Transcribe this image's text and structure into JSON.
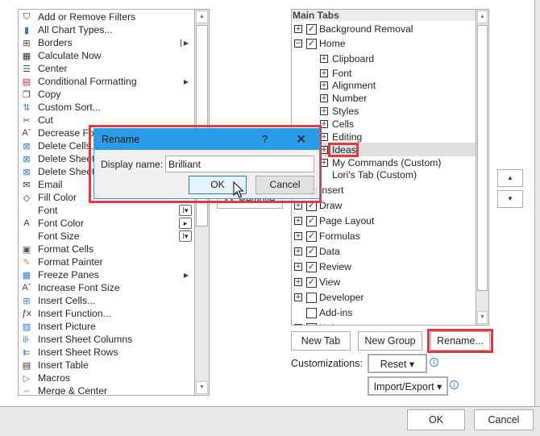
{
  "commands_list": {
    "items": [
      {
        "label": "Add or Remove Filters",
        "icon": "filter-icon",
        "glyph": "⛉"
      },
      {
        "label": "All Chart Types...",
        "icon": "chart-icon",
        "glyph": "▮"
      },
      {
        "label": "Borders",
        "icon": "borders-icon",
        "glyph": "⊞",
        "submenu": "bar"
      },
      {
        "label": "Calculate Now",
        "icon": "calculator-icon",
        "glyph": "▦"
      },
      {
        "label": "Center",
        "icon": "center-align-icon",
        "glyph": "☰"
      },
      {
        "label": "Conditional Formatting",
        "icon": "conditional-formatting-icon",
        "glyph": "▤",
        "submenu": "arrow"
      },
      {
        "label": "Copy",
        "icon": "copy-icon",
        "glyph": "❐"
      },
      {
        "label": "Custom Sort...",
        "icon": "sort-icon",
        "glyph": "⇅"
      },
      {
        "label": "Cut",
        "icon": "scissors-icon",
        "glyph": "✂"
      },
      {
        "label": "Decrease Font Size",
        "icon": "decrease-font-icon",
        "glyph": "Aˇ"
      },
      {
        "label": "Delete Cells...",
        "icon": "delete-cells-icon",
        "glyph": "⊠"
      },
      {
        "label": "Delete Sheet Columns",
        "icon": "delete-columns-icon",
        "glyph": "⊠"
      },
      {
        "label": "Delete Sheet Rows",
        "icon": "delete-rows-icon",
        "glyph": "⊠"
      },
      {
        "label": "Email",
        "icon": "email-icon",
        "glyph": "✉"
      },
      {
        "label": "Fill Color",
        "icon": "fill-color-icon",
        "glyph": "◇"
      },
      {
        "label": "Font",
        "icon": "",
        "glyph": "",
        "control": "I▾"
      },
      {
        "label": "Font Color",
        "icon": "font-color-icon",
        "glyph": "A",
        "control": "▸"
      },
      {
        "label": "Font Size",
        "icon": "",
        "glyph": "",
        "control": "I▾"
      },
      {
        "label": "Format Cells",
        "icon": "format-cells-icon",
        "glyph": "▣"
      },
      {
        "label": "Format Painter",
        "icon": "format-painter-icon",
        "glyph": "✎"
      },
      {
        "label": "Freeze Panes",
        "icon": "freeze-panes-icon",
        "glyph": "▦",
        "submenu": "arrow"
      },
      {
        "label": "Increase Font Size",
        "icon": "increase-font-icon",
        "glyph": "Aˆ"
      },
      {
        "label": "Insert Cells...",
        "icon": "insert-cells-icon",
        "glyph": "⊞"
      },
      {
        "label": "Insert Function...",
        "icon": "function-icon",
        "glyph": "ƒx"
      },
      {
        "label": "Insert Picture",
        "icon": "picture-icon",
        "glyph": "▨"
      },
      {
        "label": "Insert Sheet Columns",
        "icon": "insert-columns-icon",
        "glyph": "⊪"
      },
      {
        "label": "Insert Sheet Rows",
        "icon": "insert-rows-icon",
        "glyph": "⇇"
      },
      {
        "label": "Insert Table",
        "icon": "table-icon",
        "glyph": "▤"
      },
      {
        "label": "Macros",
        "icon": "macros-icon",
        "glyph": "▷"
      },
      {
        "label": "Merge & Center",
        "icon": "merge-center-icon",
        "glyph": "⇔"
      }
    ],
    "scroll_up": "▲",
    "scroll_down": "▼"
  },
  "middle": {
    "remove_label": "<< Remove"
  },
  "tabs_tree": {
    "header": "Main Tabs",
    "nodes": [
      {
        "label": "Background Removal",
        "level": 0,
        "expander": "⊞",
        "checked": true
      },
      {
        "label": "Home",
        "level": 0,
        "expander": "⊟",
        "checked": true
      },
      {
        "label": "Clipboard",
        "level": 1,
        "expander": "⊞"
      },
      {
        "label": "Font",
        "level": 1,
        "expander": "⊞"
      },
      {
        "label": "Alignment",
        "level": 1,
        "expander": "⊞"
      },
      {
        "label": "Number",
        "level": 1,
        "expander": "⊞"
      },
      {
        "label": "Styles",
        "level": 1,
        "expander": "⊞"
      },
      {
        "label": "Cells",
        "level": 1,
        "expander": "⊞"
      },
      {
        "label": "Editing",
        "level": 1,
        "expander": "⊞"
      },
      {
        "label": "Ideas",
        "level": 1,
        "expander": "⊞",
        "selected": true
      },
      {
        "label": "My Commands (Custom)",
        "level": 1,
        "expander": "⊞"
      },
      {
        "label": "Lori's Tab (Custom)",
        "level": 1,
        "expander": ""
      },
      {
        "label": "Insert",
        "level": 0,
        "expander": "⊞",
        "checked": true
      },
      {
        "label": "Draw",
        "level": 0,
        "expander": "⊞",
        "checked": true
      },
      {
        "label": "Page Layout",
        "level": 0,
        "expander": "⊞",
        "checked": true
      },
      {
        "label": "Formulas",
        "level": 0,
        "expander": "⊞",
        "checked": true
      },
      {
        "label": "Data",
        "level": 0,
        "expander": "⊞",
        "checked": true
      },
      {
        "label": "Review",
        "level": 0,
        "expander": "⊞",
        "checked": true
      },
      {
        "label": "View",
        "level": 0,
        "expander": "⊞",
        "checked": true
      },
      {
        "label": "Developer",
        "level": 0,
        "expander": "⊞",
        "checked": false
      },
      {
        "label": "Add-ins",
        "level": 0,
        "expander": "",
        "checked": false
      },
      {
        "label": "Help",
        "level": 0,
        "expander": "⊞",
        "checked": true
      }
    ],
    "move_up": "▲",
    "move_down": "▼"
  },
  "tree_buttons": {
    "new_tab": "New Tab",
    "new_group": "New Group",
    "rename": "Rename..."
  },
  "customizations": {
    "label": "Customizations:",
    "reset": "Reset ▾",
    "import_export": "Import/Export ▾",
    "info_glyph": "i"
  },
  "footer": {
    "ok": "OK",
    "cancel": "Cancel"
  },
  "rename_dialog": {
    "title": "Rename",
    "help": "?",
    "close": "✕",
    "display_name_label": "Display name:",
    "display_name_value": "Brilliant",
    "ok": "OK",
    "cancel": "Cancel"
  },
  "colors": {
    "accent_blue": "#2b9de8",
    "highlight_red": "#e8383d",
    "selection_gray": "#e0e0e0"
  }
}
